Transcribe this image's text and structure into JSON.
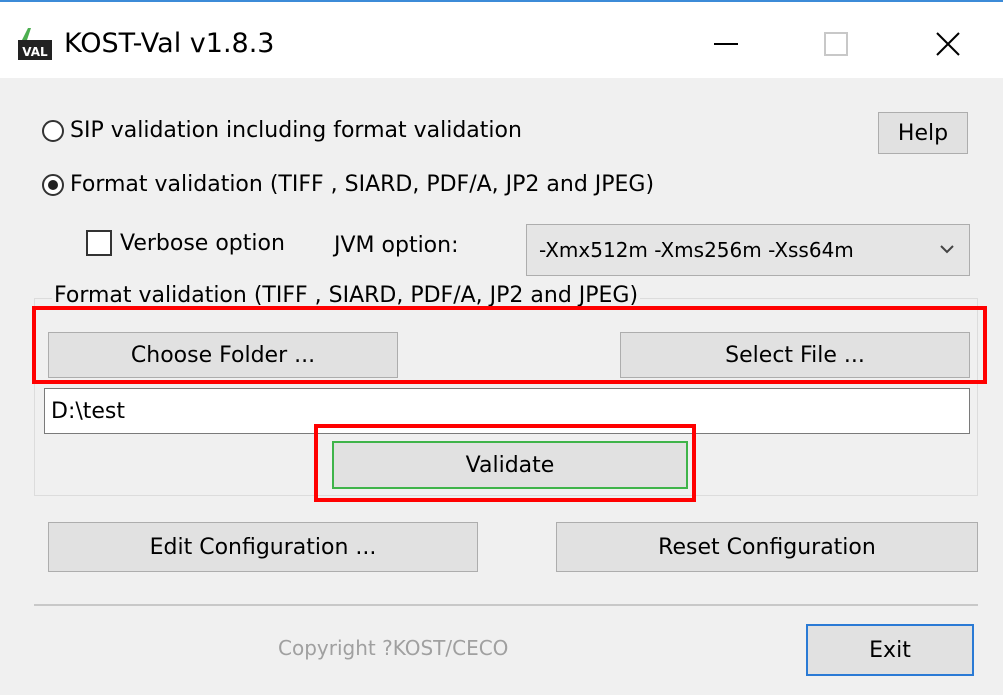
{
  "window": {
    "title": "KOST-Val v1.8.3",
    "icon_text": "VAL",
    "accent": "#3c8bd8"
  },
  "controls": {
    "minimize_icon": "minimize-icon",
    "maximize_icon": "maximize-icon",
    "close_icon": "close-icon"
  },
  "options": {
    "sip_label": "SIP validation including format validation",
    "format_label": "Format validation (TIFF , SIARD, PDF/A, JP2 and JPEG)",
    "selected": "format"
  },
  "help_label": "Help",
  "verbose_label": "Verbose option",
  "jvm_label": "JVM option:",
  "jvm_value": "-Xmx512m -Xms256m -Xss64m",
  "group_title": "Format validation (TIFF , SIARD, PDF/A, JP2 and JPEG)",
  "choose_folder_label": "Choose Folder ...",
  "select_file_label": "Select File ...",
  "path_value": "D:\\test",
  "validate_label": "Validate",
  "edit_config_label": "Edit Configuration ...",
  "reset_config_label": "Reset Configuration",
  "copyright": "Copyright ?KOST/CECO",
  "exit_label": "Exit",
  "highlight_color": "#ff0000"
}
